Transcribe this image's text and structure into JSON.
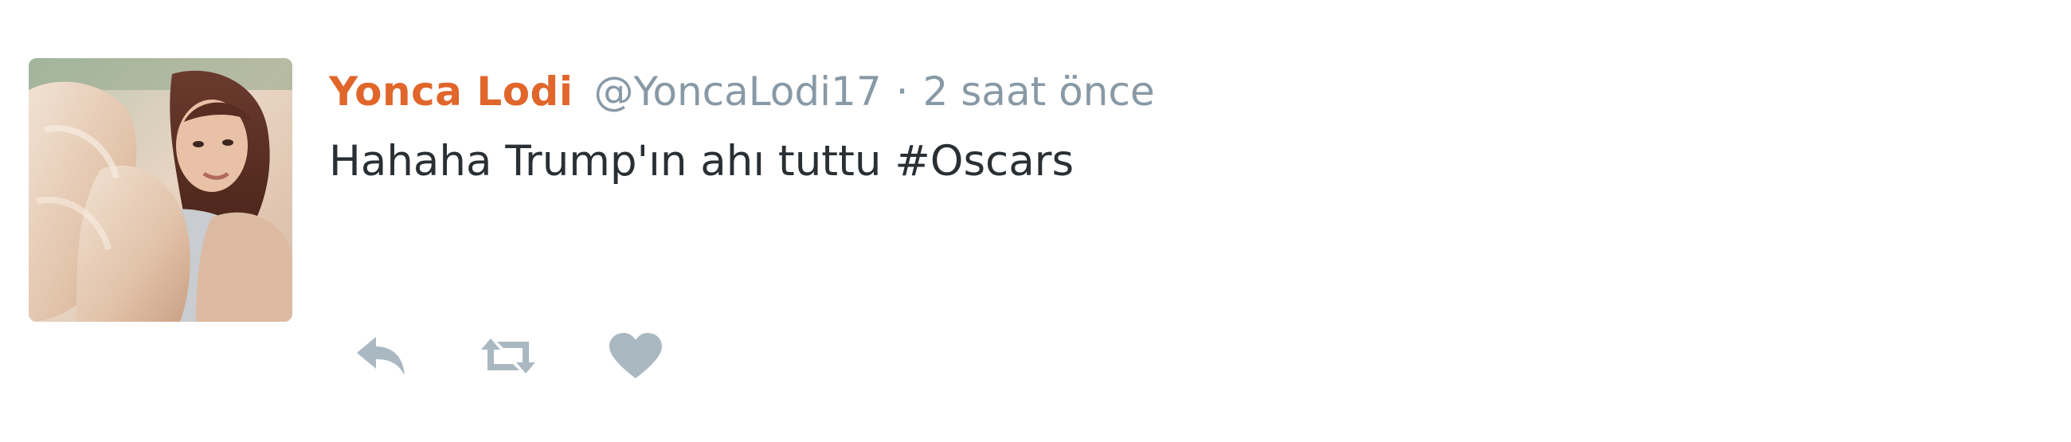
{
  "tweet": {
    "display_name": "Yonca Lodi",
    "handle": "@YoncaLodi17",
    "separator": "·",
    "time": "2 saat önce",
    "text_prefix": "Hahaha Trump'ın ahı tuttu ",
    "hashtag": "#Oscars"
  },
  "icons": {
    "reply": "reply-icon",
    "retweet": "retweet-icon",
    "like": "heart-icon"
  },
  "colors": {
    "name": "#e0662b",
    "meta": "#8899a6",
    "text": "#292f33",
    "action_icon": "#aab8c2"
  }
}
